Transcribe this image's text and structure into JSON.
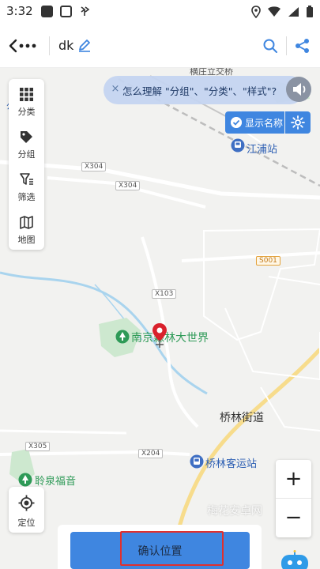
{
  "status_bar": {
    "time": "3:32"
  },
  "header": {
    "title": "dk"
  },
  "tip": {
    "text": "怎么理解 \"分组\"、\"分类\"、\"样式\"?"
  },
  "display_name": {
    "label": "显示名称"
  },
  "left_toolbar": {
    "items": [
      {
        "label": "分类",
        "icon": "grid-icon"
      },
      {
        "label": "分组",
        "icon": "tag-icon"
      },
      {
        "label": "筛选",
        "icon": "filter-icon"
      },
      {
        "label": "地图",
        "icon": "map-icon"
      }
    ]
  },
  "locate": {
    "label": "定位"
  },
  "map_labels": {
    "bridge": "横庄立交桥",
    "station_top": "江浦站",
    "road_x304_a": "X304",
    "road_x304_b": "X304",
    "road_x103": "X103",
    "road_s001": "S001",
    "road_x305": "X305",
    "road_x204": "X204",
    "park": "南京森林大世界",
    "street": "桥林街道",
    "bus_station": "桥林客运站",
    "church": "聆泉福音",
    "edge_left": "公"
  },
  "zoom": {
    "in_label": "+",
    "out_label": "−"
  },
  "watermark": "梅花安卓网",
  "confirm": {
    "label": "确认位置"
  },
  "colors": {
    "accent": "#3f86e0",
    "highlight": "#e0302e",
    "marker": "#d9212c",
    "park_green": "#2e9a57"
  }
}
